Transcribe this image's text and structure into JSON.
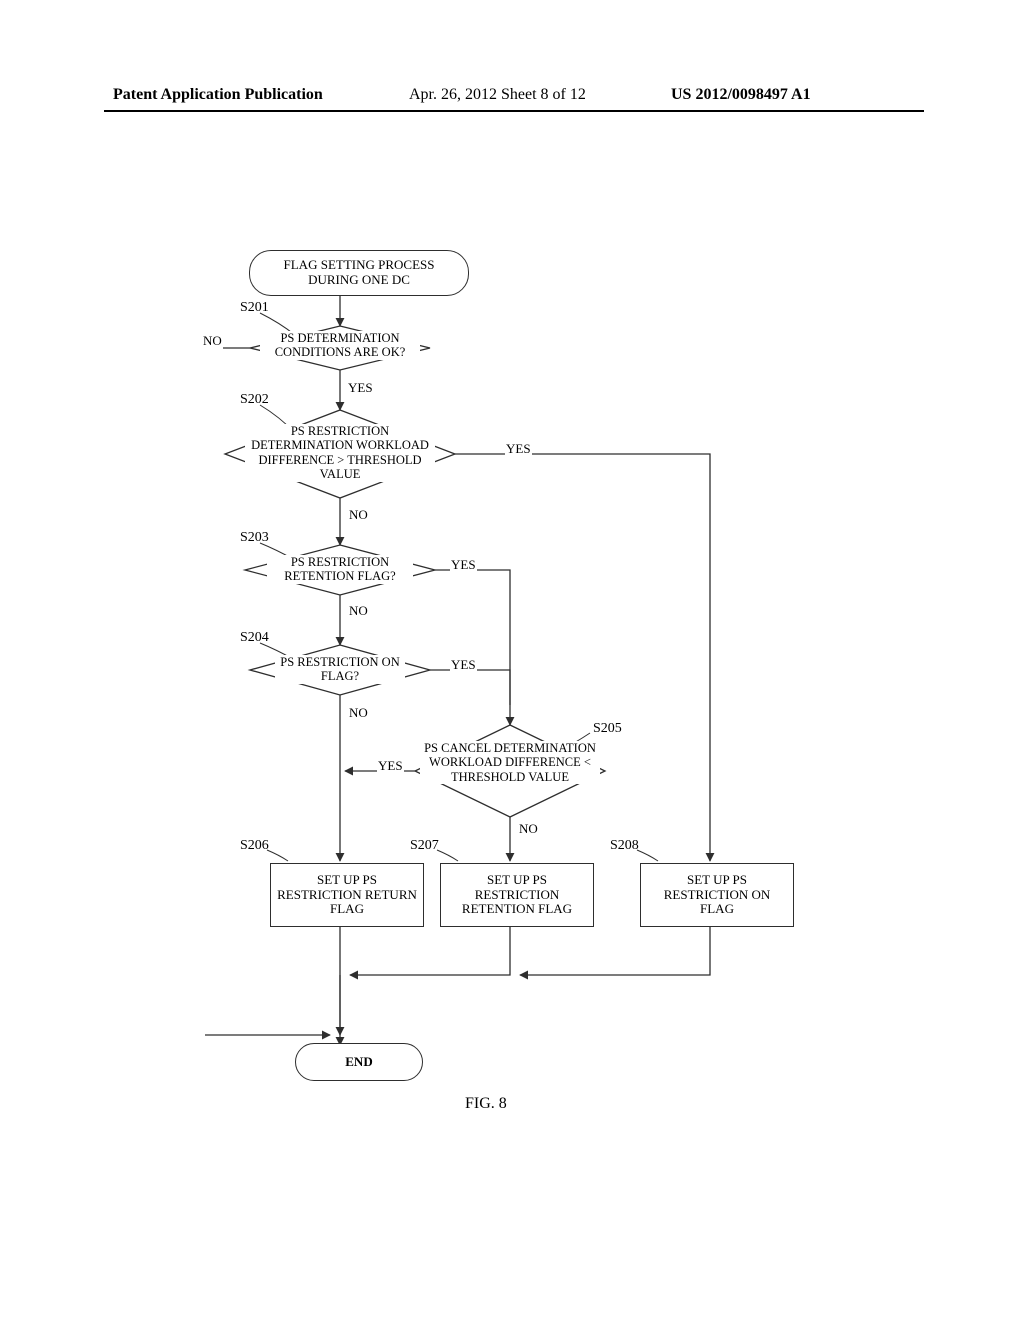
{
  "header": {
    "left": "Patent Application Publication",
    "center": "Apr. 26, 2012  Sheet 8 of 12",
    "right": "US 2012/0098497 A1"
  },
  "figure_caption": "FIG. 8",
  "flow": {
    "start": "FLAG SETTING PROCESS DURING ONE DC",
    "end": "END",
    "steps": {
      "s201": {
        "label": "S201",
        "text": "PS DETERMINATION CONDITIONS ARE OK?"
      },
      "s202": {
        "label": "S202",
        "text": "PS RESTRICTION DETERMINATION WORKLOAD DIFFERENCE > THRESHOLD VALUE"
      },
      "s203": {
        "label": "S203",
        "text": "PS RESTRICTION RETENTION FLAG?"
      },
      "s204": {
        "label": "S204",
        "text": "PS RESTRICTION ON FLAG?"
      },
      "s205": {
        "label": "S205",
        "text": "PS CANCEL DETERMINATION WORKLOAD DIFFERENCE < THRESHOLD VALUE"
      },
      "s206": {
        "label": "S206",
        "text": "SET UP PS RESTRICTION RETURN FLAG"
      },
      "s207": {
        "label": "S207",
        "text": "SET UP PS RESTRICTION RETENTION FLAG"
      },
      "s208": {
        "label": "S208",
        "text": "SET UP PS RESTRICTION ON FLAG"
      }
    },
    "edge_labels": {
      "yes": "YES",
      "no": "NO"
    }
  },
  "chart_data": {
    "type": "flowchart",
    "title": "FIG. 8",
    "nodes": [
      {
        "id": "start",
        "type": "terminator",
        "text": "FLAG SETTING PROCESS DURING ONE DC"
      },
      {
        "id": "s201",
        "type": "decision",
        "label": "S201",
        "text": "PS DETERMINATION CONDITIONS ARE OK?"
      },
      {
        "id": "s202",
        "type": "decision",
        "label": "S202",
        "text": "PS RESTRICTION DETERMINATION WORKLOAD DIFFERENCE > THRESHOLD VALUE"
      },
      {
        "id": "s203",
        "type": "decision",
        "label": "S203",
        "text": "PS RESTRICTION RETENTION FLAG?"
      },
      {
        "id": "s204",
        "type": "decision",
        "label": "S204",
        "text": "PS RESTRICTION ON FLAG?"
      },
      {
        "id": "s205",
        "type": "decision",
        "label": "S205",
        "text": "PS CANCEL DETERMINATION WORKLOAD DIFFERENCE < THRESHOLD VALUE"
      },
      {
        "id": "s206",
        "type": "process",
        "label": "S206",
        "text": "SET UP PS RESTRICTION RETURN FLAG"
      },
      {
        "id": "s207",
        "type": "process",
        "label": "S207",
        "text": "SET UP PS RESTRICTION RETENTION FLAG"
      },
      {
        "id": "s208",
        "type": "process",
        "label": "S208",
        "text": "SET UP PS RESTRICTION ON FLAG"
      },
      {
        "id": "end",
        "type": "terminator",
        "text": "END"
      }
    ],
    "edges": [
      {
        "from": "start",
        "to": "s201"
      },
      {
        "from": "s201",
        "to": "s202",
        "label": "YES"
      },
      {
        "from": "s201",
        "to": "end",
        "label": "NO"
      },
      {
        "from": "s202",
        "to": "s208",
        "label": "YES"
      },
      {
        "from": "s202",
        "to": "s203",
        "label": "NO"
      },
      {
        "from": "s203",
        "to": "s205",
        "label": "YES"
      },
      {
        "from": "s203",
        "to": "s204",
        "label": "NO"
      },
      {
        "from": "s204",
        "to": "s205",
        "label": "YES"
      },
      {
        "from": "s204",
        "to": "s206",
        "label": "NO"
      },
      {
        "from": "s205",
        "to": "s206",
        "label": "YES"
      },
      {
        "from": "s205",
        "to": "s207",
        "label": "NO"
      },
      {
        "from": "s206",
        "to": "end"
      },
      {
        "from": "s207",
        "to": "end"
      },
      {
        "from": "s208",
        "to": "end"
      }
    ]
  }
}
